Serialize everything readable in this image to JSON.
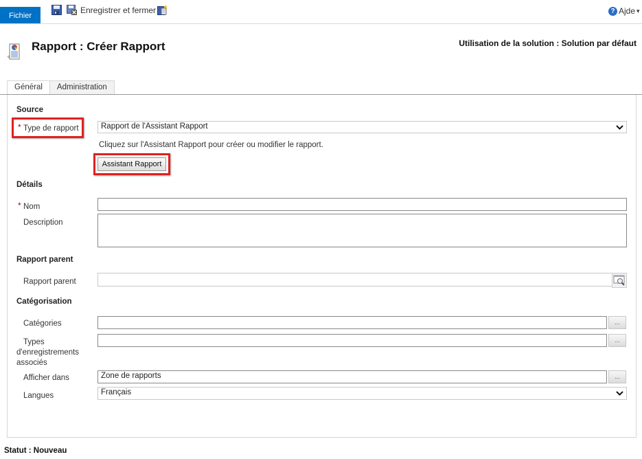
{
  "ribbon": {
    "file_tab": "Fichier",
    "save_close_label": "Enregistrer et fermer",
    "help_label": "Ajde",
    "help_glyph": "?",
    "help_chevron": "▾"
  },
  "header": {
    "title": "Rapport : Créer Rapport",
    "solution": "Utilisation de la solution : Solution par défaut"
  },
  "tabs": [
    {
      "label": "Général",
      "active": true
    },
    {
      "label": "Administration",
      "active": false
    }
  ],
  "form": {
    "required_mark": "*",
    "source": {
      "heading": "Source",
      "report_type_label": "Type de rapport",
      "report_type_value": "Rapport de l'Assistant Rapport",
      "hint": "Cliquez sur l'Assistant Rapport pour créer ou modifier le rapport.",
      "wizard_button": "Assistant Rapport"
    },
    "details": {
      "heading": "Détails",
      "name_label": "Nom",
      "name_value": "",
      "description_label": "Description",
      "description_value": ""
    },
    "parent": {
      "heading": "Rapport parent",
      "parent_label": "Rapport parent",
      "parent_value": ""
    },
    "categorization": {
      "heading": "Catégorisation",
      "categories_label": "Catégories",
      "categories_value": "",
      "record_types_label_1": "Types",
      "record_types_label_2": "d'enregistrements",
      "record_types_label_3": "associés",
      "record_types_value": "",
      "display_in_label": "Afficher dans",
      "display_in_value": "Zone de rapports",
      "languages_label": "Langues",
      "languages_value": "Français",
      "ellipsis": "..."
    }
  },
  "chevron_glyph": "⌄",
  "status": "Statut : Nouveau",
  "colors": {
    "accent": "#0072c6",
    "highlight": "#e02020",
    "required": "#bb0000"
  }
}
